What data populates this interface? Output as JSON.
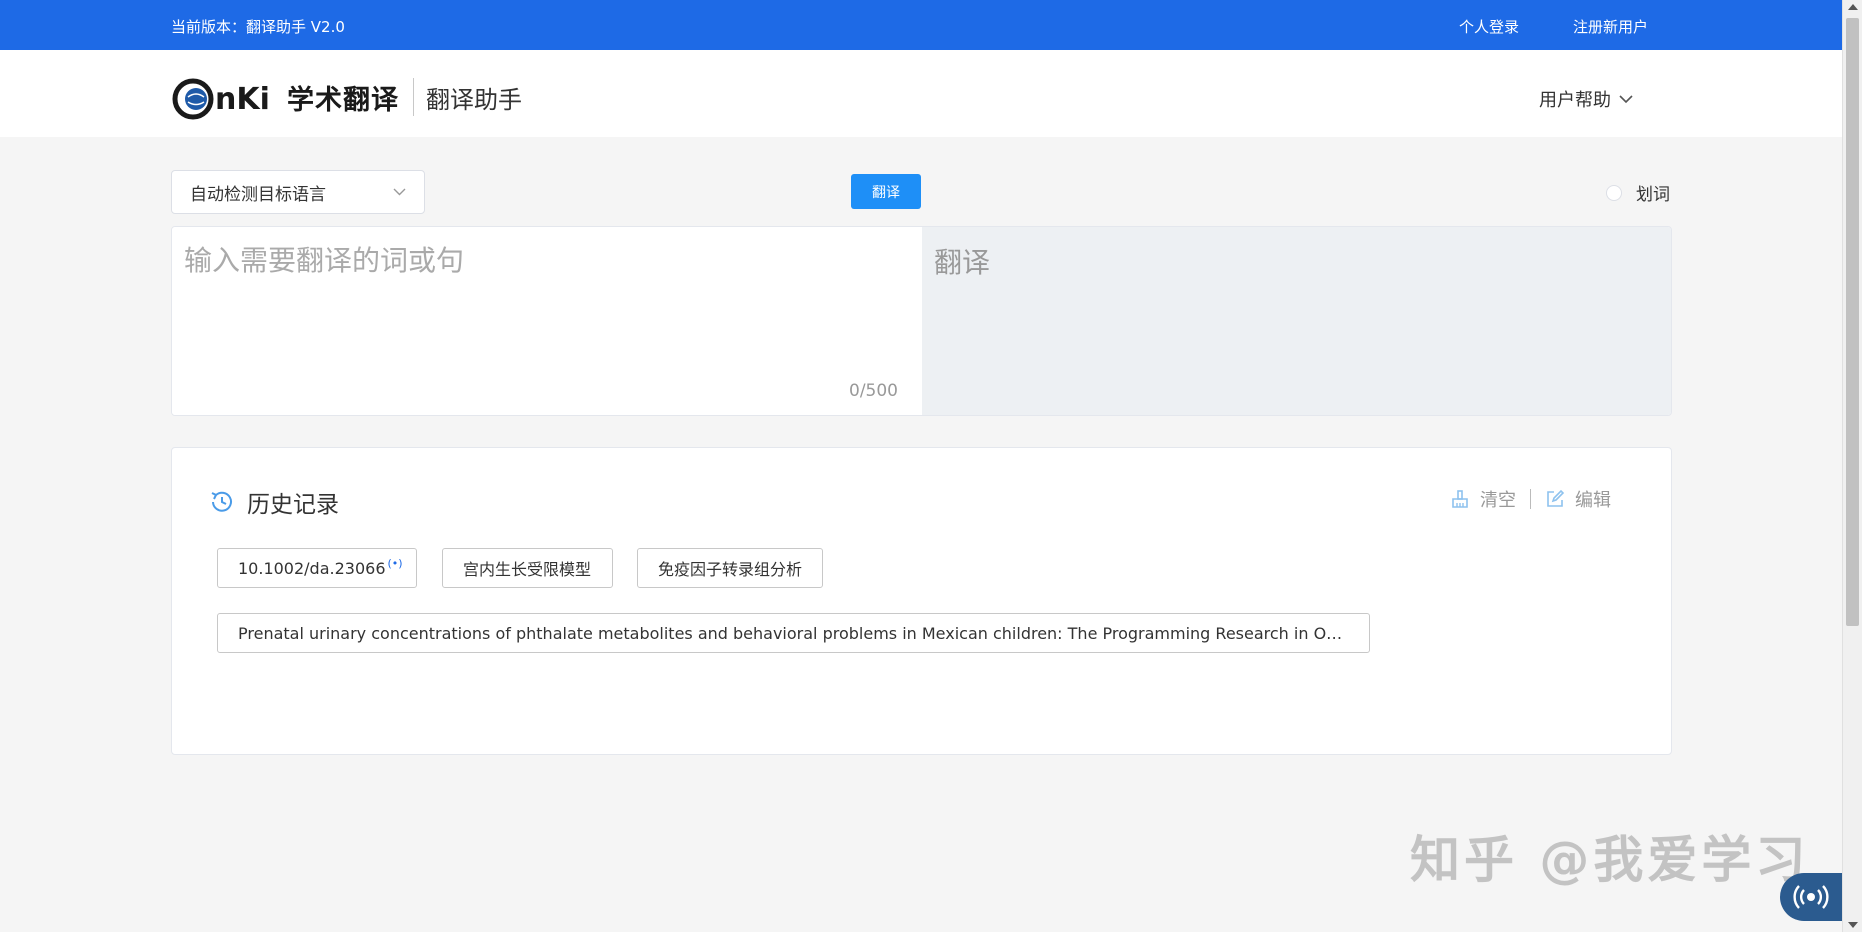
{
  "topbar": {
    "version": "当前版本：翻译助手 V2.0",
    "login": "个人登录",
    "register": "注册新用户"
  },
  "header": {
    "logo_text": "学术翻译",
    "subtitle": "翻译助手",
    "help": "用户帮助"
  },
  "toolbar": {
    "lang_select": "自动检测目标语言",
    "translate_button": "翻译",
    "huaci": "划词"
  },
  "translator": {
    "input_placeholder": "输入需要翻译的词或句",
    "counter": "0/500",
    "output_placeholder": "翻译"
  },
  "history": {
    "title": "历史记录",
    "clear": "清空",
    "edit": "编辑",
    "items": [
      "10.1002/da.23066",
      "宫内生长受限模型",
      "免疫因子转录组分析",
      "Prenatal urinary concentrations of phthalate metabolites and behavioral problems in Mexican children: The Programming Research in Obesit..."
    ]
  },
  "watermark": "知乎 @我爱学习",
  "colors": {
    "topbar": "#1e6ae6",
    "button": "#1e8ff7",
    "output_bg": "#edf0f3",
    "page_bg": "#f5f5f5"
  }
}
